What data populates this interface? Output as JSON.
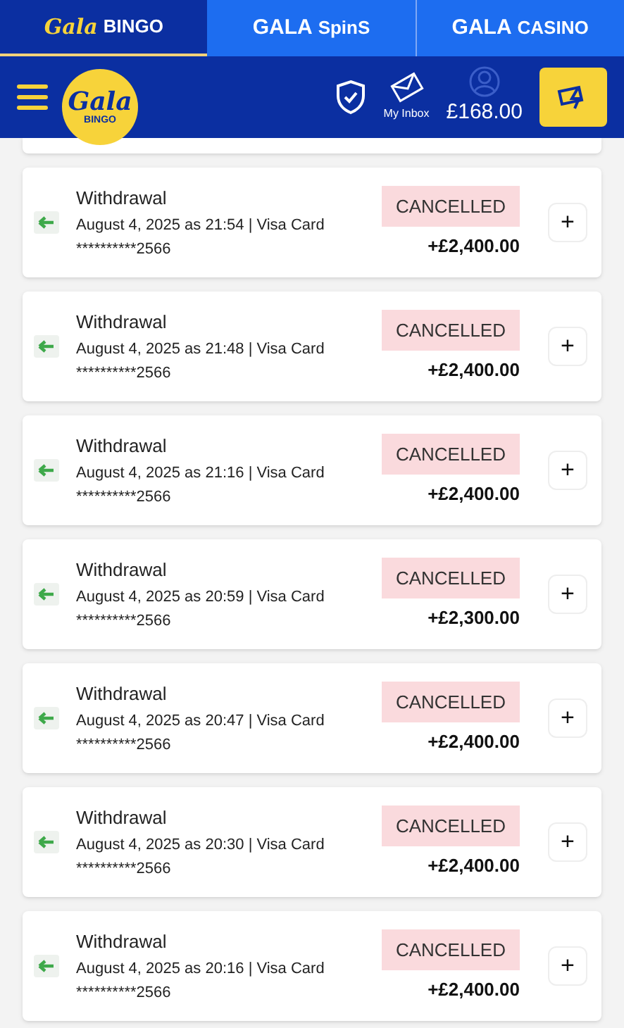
{
  "site_tabs": [
    {
      "brand": "Gala",
      "label": "BINGO",
      "selected": true
    },
    {
      "brand": "GALA",
      "label": "SpinS",
      "selected": false
    },
    {
      "brand": "GALA",
      "label": "CASINO",
      "selected": false
    }
  ],
  "header": {
    "logo_top": "Gala",
    "logo_bottom": "BINGO",
    "inbox_label": "My Inbox",
    "balance": "£168.00"
  },
  "transactions": [
    {
      "type": "Withdrawal",
      "details": "August 4, 2025 as 21:54 | Visa Card",
      "card": "**********2566",
      "status": "CANCELLED",
      "amount": "+£2,400.00"
    },
    {
      "type": "Withdrawal",
      "details": "August 4, 2025 as 21:48 | Visa Card",
      "card": "**********2566",
      "status": "CANCELLED",
      "amount": "+£2,400.00"
    },
    {
      "type": "Withdrawal",
      "details": "August 4, 2025 as 21:16 | Visa Card",
      "card": "**********2566",
      "status": "CANCELLED",
      "amount": "+£2,400.00"
    },
    {
      "type": "Withdrawal",
      "details": "August 4, 2025 as 20:59 | Visa Card",
      "card": "**********2566",
      "status": "CANCELLED",
      "amount": "+£2,300.00"
    },
    {
      "type": "Withdrawal",
      "details": "August 4, 2025 as 20:47 | Visa Card",
      "card": "**********2566",
      "status": "CANCELLED",
      "amount": "+£2,400.00"
    },
    {
      "type": "Withdrawal",
      "details": "August 4, 2025 as 20:30 | Visa Card",
      "card": "**********2566",
      "status": "CANCELLED",
      "amount": "+£2,400.00"
    },
    {
      "type": "Withdrawal",
      "details": "August 4, 2025 as 20:16 | Visa Card",
      "card": "**********2566",
      "status": "CANCELLED",
      "amount": "+£2,400.00"
    }
  ],
  "expand_symbol": "+"
}
